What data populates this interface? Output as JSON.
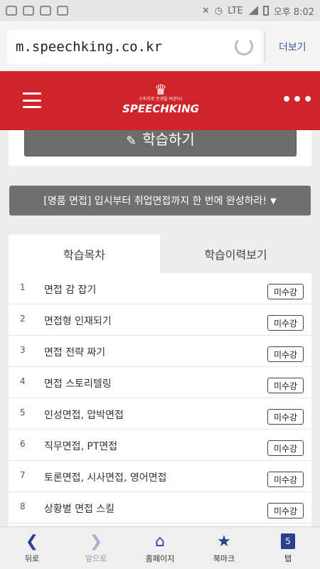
{
  "status_bar": {
    "network": "LTE",
    "time": "오후 8:02"
  },
  "browser": {
    "url": "m.speechking.co.kr",
    "more_label": "더보기"
  },
  "header": {
    "logo_tagline": "스피치로 인생을 바꾼다!",
    "logo_text": "SPEECHKING",
    "menu_dots": "•••"
  },
  "study_button_label": "학습하기",
  "course_dropdown": "[명품 면접] 입시부터 취업면접까지 한 번에 완성하라!",
  "tabs": [
    {
      "label": "학습목차"
    },
    {
      "label": "학습이력보기"
    }
  ],
  "lessons": [
    {
      "num": "1",
      "title": "면접 감 잡기",
      "status": "미수강"
    },
    {
      "num": "2",
      "title": "면접형 인재되기",
      "status": "미수강"
    },
    {
      "num": "3",
      "title": "면접 전략 짜기",
      "status": "미수강"
    },
    {
      "num": "4",
      "title": "면접 스토리텔링",
      "status": "미수강"
    },
    {
      "num": "5",
      "title": "인성면접, 압박면접",
      "status": "미수강"
    },
    {
      "num": "6",
      "title": "직무면접, PT면접",
      "status": "미수강"
    },
    {
      "num": "7",
      "title": "토론면접, 시사면접, 영어면접",
      "status": "미수강"
    },
    {
      "num": "8",
      "title": "상황별 면접 스킬",
      "status": "미수강"
    }
  ],
  "bottom_nav": {
    "back": "뒤로",
    "forward": "앞으로",
    "home": "홈페이지",
    "bookmark": "북마크",
    "tabs": "탭",
    "tab_count": "5"
  },
  "colors": {
    "header_red": "#d0232a",
    "nav_blue": "#2d3f8f"
  }
}
